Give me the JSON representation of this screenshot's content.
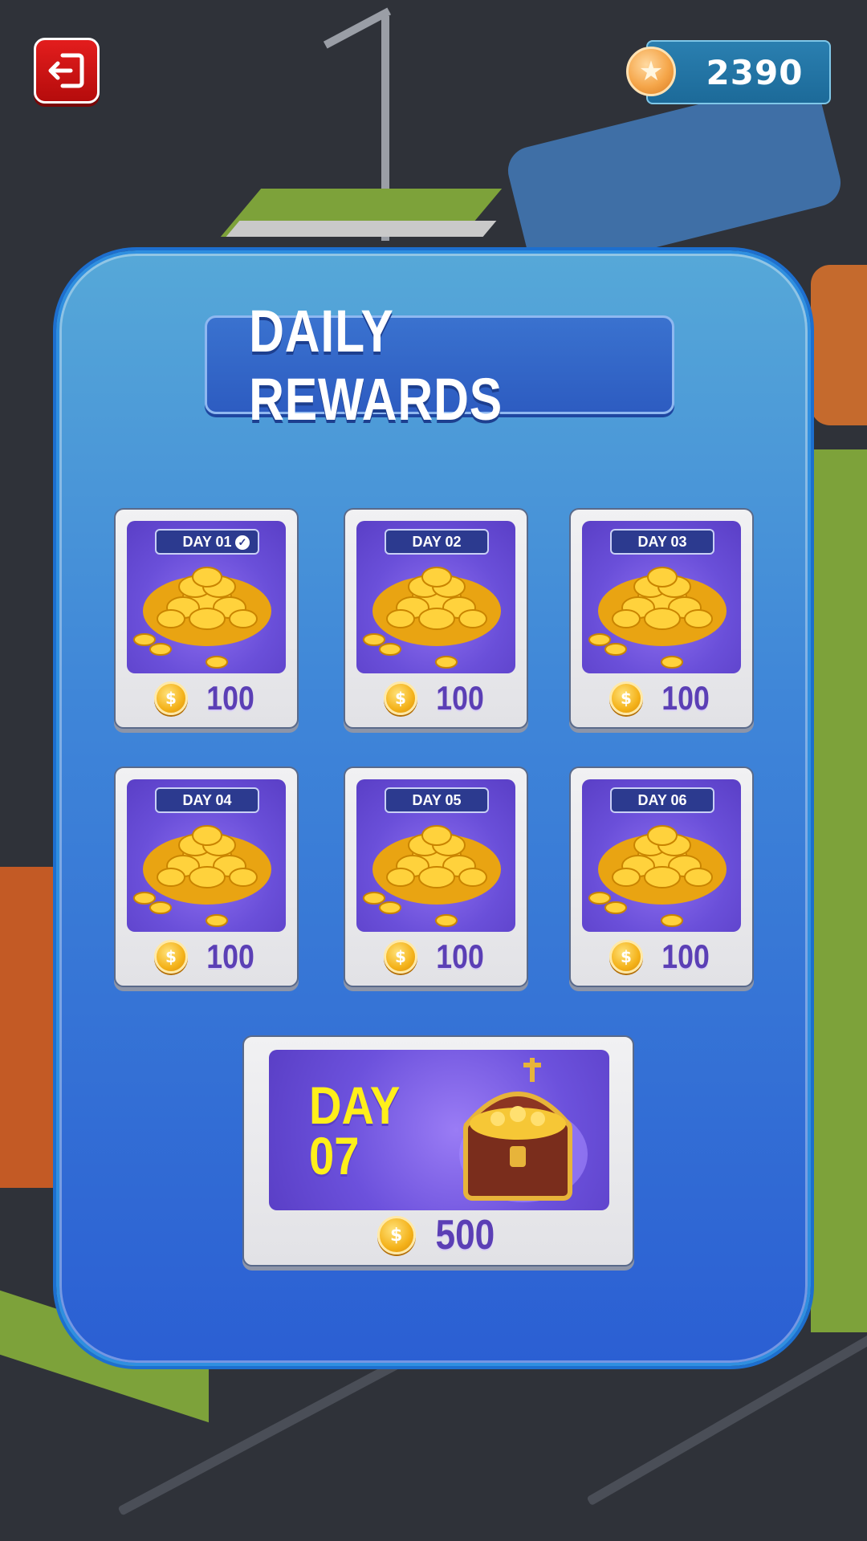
{
  "header": {
    "exit_icon": "exit-icon",
    "coin_icon": "star-coin-icon",
    "coins": "2390"
  },
  "panel": {
    "title": "DAILY REWARDS"
  },
  "rewards": [
    {
      "day": "DAY 01",
      "amount": "100",
      "claimed": true
    },
    {
      "day": "DAY 02",
      "amount": "100",
      "claimed": false
    },
    {
      "day": "DAY 03",
      "amount": "100",
      "claimed": false
    },
    {
      "day": "DAY 04",
      "amount": "100",
      "claimed": false
    },
    {
      "day": "DAY 05",
      "amount": "100",
      "claimed": false
    },
    {
      "day": "DAY 06",
      "amount": "100",
      "claimed": false
    }
  ],
  "grand_reward": {
    "day_word": "DAY",
    "day_number": "07",
    "amount": "500",
    "icon": "treasure-chest-icon"
  },
  "colors": {
    "panel": "#3f86d8",
    "title_plate": "#2d5cc1",
    "amount_text": "#5b3fb5",
    "day7_text": "#ffef1a",
    "exit_button": "#d31414"
  }
}
